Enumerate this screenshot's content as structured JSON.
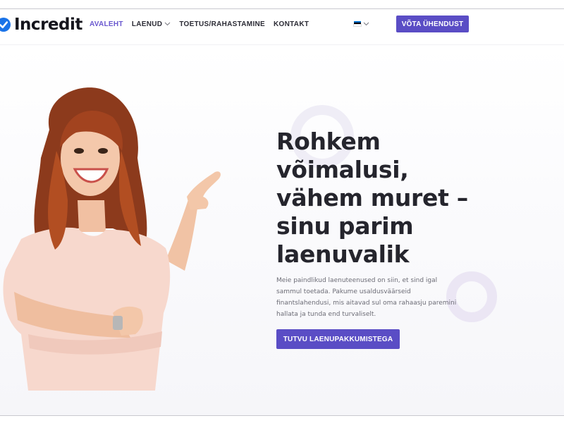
{
  "brand": {
    "name": "Incredit",
    "logo_icon": "incredit-logo-icon",
    "primary_color": "#5a4dc5",
    "active_nav_color": "#6a58cf"
  },
  "nav": {
    "items": [
      {
        "label": "AVALEHT",
        "active": true
      },
      {
        "label": "LAENUD",
        "has_dropdown": true
      },
      {
        "label": "TOETUS/RAHASTAMINE"
      },
      {
        "label": "KONTAKT"
      }
    ]
  },
  "language": {
    "flag": "estonia-flag-icon",
    "flag_colors": [
      "#0072ce",
      "#000000",
      "#ffffff"
    ]
  },
  "header_cta": {
    "label": "VÕTA ÜHENDUST"
  },
  "hero": {
    "title": "Rohkem võimalusi, vähem muret – sinu parim laenuvalik",
    "description": "Meie paindlikud laenuteenused on siin, et sind igal sammul toetada. Pakume usaldusväärseid finantslahendusi, mis aitavad sul oma rahaasju paremini hallata ja tunda end turvaliselt.",
    "cta": {
      "label": "TUTVU LAENUPAKKUMISTEGA"
    },
    "image": "smiling-woman-pointing-photo"
  }
}
